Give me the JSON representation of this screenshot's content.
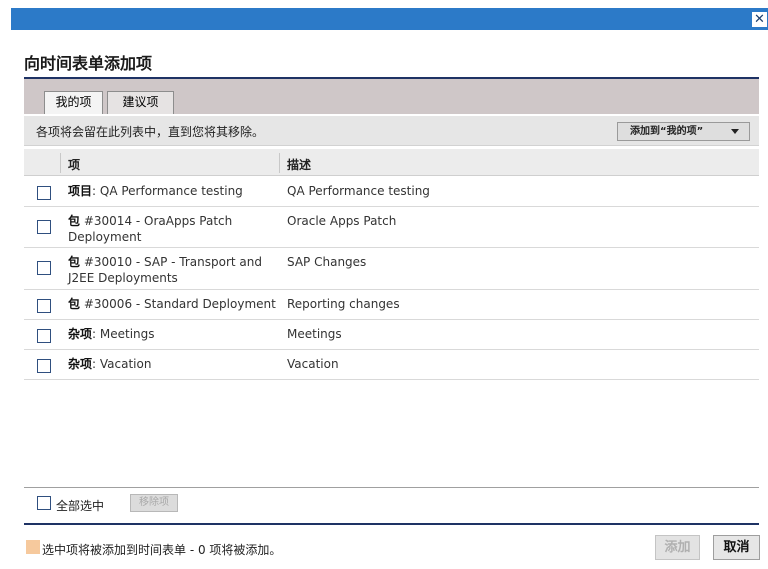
{
  "dialog": {
    "title": "向时间表单添加项",
    "close_glyph": "✕"
  },
  "tabs": [
    {
      "label": "我的项",
      "active": true
    },
    {
      "label": "建议项",
      "active": false
    }
  ],
  "info": {
    "text": "各项将会留在此列表中，直到您将其移除。",
    "add_to_mine_label": "添加到“我的项”"
  },
  "table": {
    "columns": [
      "项",
      "描述"
    ],
    "rows": [
      {
        "kind": "项目",
        "sep": ": ",
        "name": "QA Performance testing",
        "description": "QA Performance testing"
      },
      {
        "kind": "包",
        "sep": " ",
        "name": "#30014 - OraApps Patch Deployment",
        "description": "Oracle Apps Patch"
      },
      {
        "kind": "包",
        "sep": " ",
        "name": "#30010 - SAP - Transport and J2EE Deployments",
        "description": "SAP Changes"
      },
      {
        "kind": "包",
        "sep": " ",
        "name": "#30006 - Standard Deployment",
        "description": "Reporting changes"
      },
      {
        "kind": "杂项",
        "sep": ": ",
        "name": "Meetings",
        "description": "Meetings"
      },
      {
        "kind": "杂项",
        "sep": ": ",
        "name": "Vacation",
        "description": "Vacation"
      }
    ]
  },
  "bulk": {
    "select_all_label": "全部选中",
    "remove_label": "移除项"
  },
  "footer": {
    "legend_text": "选中项将被添加到时间表单",
    "count_text": " - 0 项将被添加。",
    "add_button": "添加",
    "cancel_button": "取消"
  },
  "colors": {
    "titlebar": "#2c7ac8",
    "rule": "#1e3264",
    "legend_swatch": "#f6c99d",
    "tab_strip": "#cfc7c8"
  },
  "icons": {
    "close": "close-icon",
    "dropdown": "caret-down-icon"
  }
}
